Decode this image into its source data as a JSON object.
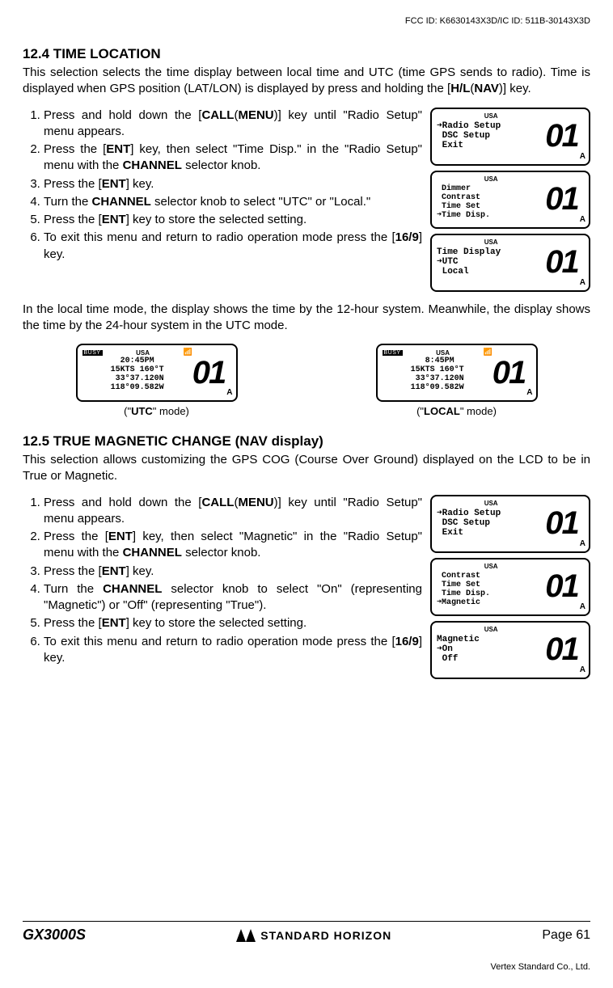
{
  "header": {
    "fcc": "FCC ID: K6630143X3D/IC ID: 511B-30143X3D"
  },
  "s124": {
    "heading": "12.4  TIME LOCATION",
    "intro": "This selection selects the time display between local time and UTC (time GPS sends to radio). Time is displayed when GPS position (LAT/LON) is displayed by press and holding the [H/L(NAV)] key.",
    "steps": {
      "i1a": "Press and hold down the [",
      "i1b": "CALL",
      "i1c": "(",
      "i1d": "MENU",
      "i1e": ")] key until \"Radio Setup\" menu appears.",
      "i2a": "Press the [",
      "i2b": "ENT",
      "i2c": "] key, then select \"Time Disp.\" in the \"Radio Setup\" menu with the ",
      "i2d": "CHANNEL",
      "i2e": " selector knob.",
      "i3a": "Press the [",
      "i3b": "ENT",
      "i3c": "] key.",
      "i4a": "Turn the ",
      "i4b": "CHANNEL",
      "i4c": " selector knob to select \"UTC\" or \"Local.\"",
      "i5a": "Press the [",
      "i5b": "ENT",
      "i5c": "] key to store  the selected setting.",
      "i6a": "To exit this menu and return to radio operation mode press the [",
      "i6b": "16/9",
      "i6c": "] key."
    },
    "mid": "In the local time mode, the display shows the time by the 12-hour system. Meanwhile, the display shows the time by the 24-hour system in the UTC mode.",
    "utc_caption_a": "(\"",
    "utc_caption_b": "UTC",
    "utc_caption_c": "\" mode)",
    "local_caption_a": "(\"",
    "local_caption_b": "LOCAL",
    "local_caption_c": "\" mode)"
  },
  "lcd124": {
    "usa": "USA",
    "d1_lines": "➜Radio Setup\n DSC Setup\n Exit",
    "d2_lines": " Dimmer\n Contrast\n Time Set\n➜Time Disp.",
    "d3_lines": "Time Display\n➜UTC\n Local",
    "big": "01",
    "sub": "A",
    "utc_lines": "20:45PM\n15KTS 160°T\n 33°37.120N\n118°09.582W",
    "local_lines": " 8:45PM\n15KTS 160°T\n 33°37.120N\n118°09.582W",
    "busy": "BUSY"
  },
  "s125": {
    "heading": "12.5  TRUE MAGNETIC CHANGE (NAV display)",
    "intro": "This selection allows customizing the GPS COG (Course Over Ground) displayed on the LCD to be in True or Magnetic.",
    "steps": {
      "i1a": "Press and hold down the [",
      "i1b": "CALL",
      "i1c": "(",
      "i1d": "MENU",
      "i1e": ")] key until \"Radio Setup\" menu appears.",
      "i2a": "Press the [",
      "i2b": "ENT",
      "i2c": "] key, then select \"Magnetic\" in the \"Radio Setup\" menu with the ",
      "i2d": "CHANNEL",
      "i2e": " selector knob.",
      "i3a": "Press the [",
      "i3b": "ENT",
      "i3c": "] key.",
      "i4a": "Turn the ",
      "i4b": "CHANNEL",
      "i4c": " selector knob to select \"On\" (representing \"Magnetic\") or \"Off\" (representing \"True\").",
      "i5a": "Press the [",
      "i5b": "ENT",
      "i5c": "] key to store the selected setting.",
      "i6a": "To exit this menu and return to radio operation mode press the [",
      "i6b": "16/9",
      "i6c": "] key."
    }
  },
  "lcd125": {
    "d1_lines": "➜Radio Setup\n DSC Setup\n Exit",
    "d2_lines": " Contrast\n Time Set\n Time Disp.\n➜Magnetic",
    "d3_lines": "Magnetic\n➜On\n Off"
  },
  "footer": {
    "model": "GX3000S",
    "brand": "STANDARD HORIZON",
    "page": "Page 61",
    "vertex": "Vertex Standard Co., Ltd."
  }
}
